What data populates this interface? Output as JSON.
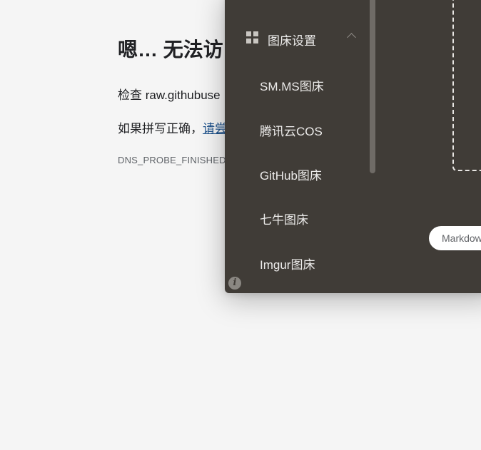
{
  "error_page": {
    "title": "嗯… 无法访",
    "line1": "检查 raw.githubuse",
    "line2_prefix": "如果拼写正确，",
    "line2_link": "请尝",
    "error_code": "DNS_PROBE_FINISHED"
  },
  "app": {
    "menu": {
      "header_label": "图床设置",
      "header_icon": "grid-icon",
      "collapse_icon": "chevron-up-icon",
      "items": [
        {
          "label": "SM.MS图床"
        },
        {
          "label": "腾讯云COS"
        },
        {
          "label": "GitHub图床"
        },
        {
          "label": "七牛图床"
        },
        {
          "label": "Imgur图床"
        }
      ]
    },
    "info_icon": "info-icon",
    "info_glyph": "i",
    "format_selector": {
      "value": "Markdow"
    }
  }
}
